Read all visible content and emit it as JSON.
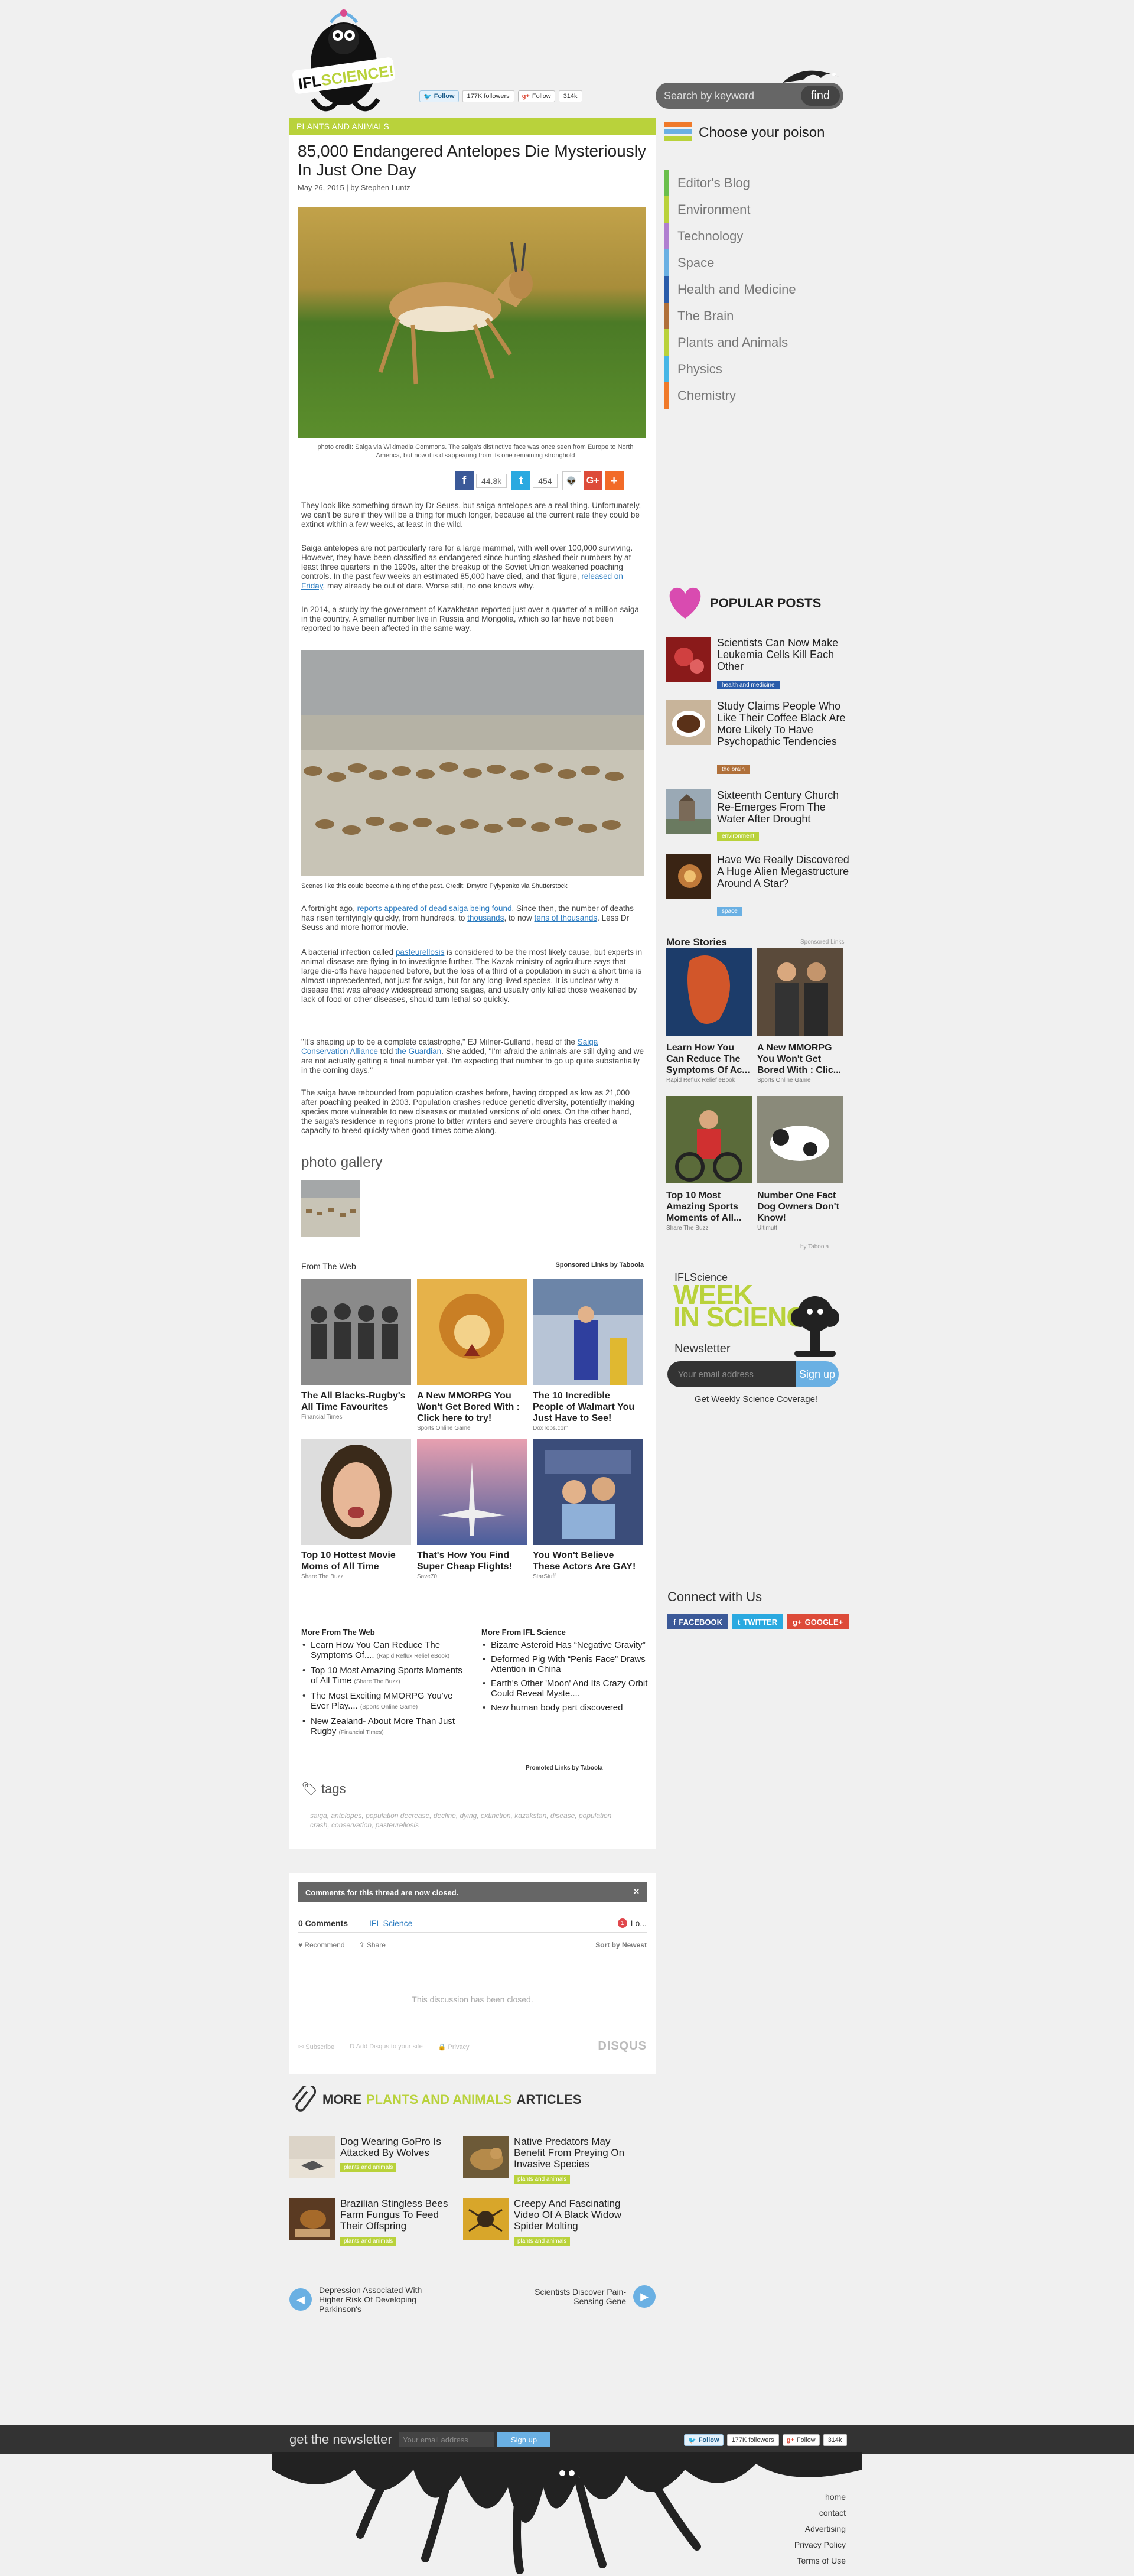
{
  "header": {
    "search_placeholder": "Search by keyword",
    "search_button": "find",
    "twitter_follow": "Follow",
    "twitter_followers": "177K followers",
    "gplus_follow": "Follow",
    "gplus_count": "314k",
    "logo_text": "IFL SCIENCE!"
  },
  "article": {
    "category": "PLANTS AND ANIMALS",
    "title": "85,000 Endangered Antelopes Die Mysteriously In Just One Day",
    "byline": "May 26, 2015 | by Stephen Luntz",
    "hero_caption": "photo credit: Saiga via Wikimedia Commons. The saiga's distinctive face was once seen from Europe to North America, but now it is disappearing from its one remaining stronghold",
    "share": {
      "facebook_count": "44.8k",
      "twitter_count": "454"
    },
    "p1": "They look like something drawn by Dr Seuss, but saiga antelopes are a real thing. Unfortunately, we can't be sure if they will be a thing for much longer, because at the current rate they could be extinct within a few weeks, at least in the wild.",
    "p2a": "Saiga antelopes are not particularly rare for a large mammal, with well over 100,000 surviving. However, they have been classified as endangered since hunting slashed their numbers by at least three quarters in the 1990s, after the breakup of the Soviet Union weakened poaching controls. In the past few weeks an estimated 85,000 have died, and that figure,",
    "p2_link": "released on Friday",
    "p2b": ", may already be out of date. Worse still, no one knows why.",
    "p3": "In 2014, a study by the government of Kazakhstan reported just over a quarter of a million saiga in the country. A smaller number live in Russia and Mongolia, which so far have not been reported to have been affected in the same way.",
    "caption2": "Scenes like this could become a thing of the past. Credit: Dmytro Pylypenko via Shutterstock",
    "p4a": "A fortnight ago,",
    "p4_link1": "reports appeared of dead saiga being found",
    "p4b": ". Since then, the number of deaths has risen terrifyingly quickly, from hundreds, to",
    "p4_link2": "thousands",
    "p4c": ", to now",
    "p4_link3": "tens of thousands",
    "p4d": ". Less Dr Seuss and more horror movie.",
    "p5a": "A bacterial infection called",
    "p5_link": "pasteurellosis",
    "p5b": "is considered to be the most likely cause, but experts in animal disease are flying in to investigate further. The Kazak ministry of agriculture says that large die-offs have happened before, but the loss of a third of a population in such a short time is almost unprecedented, not just for saiga, but for any long-lived species. It is unclear why a disease that was already widespread among saigas, and usually only killed those weakened by lack of food or other diseases, should turn lethal so quickly.",
    "p6a": "\"It's shaping up to be a complete catastrophe,\" EJ Milner-Gulland, head of the",
    "p6_link1": "Saiga Conservation Alliance",
    "p6b": "told",
    "p6_link2": "the Guardian",
    "p6c": ". She added, \"I'm afraid the animals are still dying and we are not actually getting a final number yet. I'm expecting that number to go up quite substantially in the coming days.\"",
    "p7": "The saiga have rebounded from population crashes before, having dropped as low as 21,000 after poaching peaked in 2003. Population crashes reduce genetic diversity, potentially making species more vulnerable to new diseases or mutated versions of old ones. On the other hand, the saiga's residence in regions prone to bitter winters and severe droughts has created a capacity to breed quickly when good times come along.",
    "gallery_heading": "photo gallery",
    "tags_heading": "tags",
    "tags": "saiga, antelopes, population decrease, decline, dying, extinction, kazakstan, disease, population crash, conservation, pasteurellosis"
  },
  "from_web": {
    "heading": "From The Web",
    "sponsored": "Sponsored Links by Taboola",
    "cards": [
      {
        "title": "The All Blacks-Rugby's All Time Favourites",
        "src": "Financial Times"
      },
      {
        "title": "A New MMORPG You Won't Get Bored With : Click here to try!",
        "src": "Sports Online Game"
      },
      {
        "title": "The 10 Incredible People of Walmart You Just Have to See!",
        "src": "DoxTops.com"
      },
      {
        "title": "Top 10 Hottest Movie Moms of All Time",
        "src": "Share The Buzz"
      },
      {
        "title": "That's How You Find Super Cheap Flights!",
        "src": "Save70"
      },
      {
        "title": "You Won't Believe These Actors Are GAY!",
        "src": "StarStuff"
      }
    ]
  },
  "more_lists": {
    "left_heading": "More From The Web",
    "left": [
      {
        "text": "Learn How You Can Reduce The Symptoms Of....",
        "src": "(Rapid Reflux Relief eBook)"
      },
      {
        "text": "Top 10 Most Amazing Sports Moments of All Time",
        "src": "(Share The Buzz)"
      },
      {
        "text": "The Most Exciting MMORPG You've Ever Play....",
        "src": "(Sports Online Game)"
      },
      {
        "text": "New Zealand- About More Than Just Rugby",
        "src": "(Financial Times)"
      }
    ],
    "right_heading": "More From IFL Science",
    "right": [
      {
        "text": "Bizarre Asteroid Has “Negative Gravity”"
      },
      {
        "text": "Deformed Pig With “Penis Face” Draws Attention in China"
      },
      {
        "text": "Earth's Other 'Moon' And Its Crazy Orbit Could Reveal Myste...."
      },
      {
        "text": "New human body part discovered"
      }
    ],
    "promoted": "Promoted Links by Taboola"
  },
  "comments": {
    "closed_bar": "Comments for this thread are now closed.",
    "count": "0 Comments",
    "community": "IFL Science",
    "login": "Lo...",
    "recommend": "Recommend",
    "share": "Share",
    "sort": "Sort by Newest",
    "closed_msg": "This discussion has been closed.",
    "subscribe": "Subscribe",
    "add_disqus": "Add Disqus to your site",
    "privacy": "Privacy",
    "disqus": "DISQUS"
  },
  "more_articles": {
    "heading_pre": "MORE",
    "heading_cat": "PLANTS AND ANIMALS",
    "heading_post": "ARTICLES",
    "items": [
      {
        "title": "Dog Wearing GoPro Is Attacked By Wolves",
        "tag": "plants and animals"
      },
      {
        "title": "Native Predators May Benefit From Preying On Invasive Species",
        "tag": "plants and animals"
      },
      {
        "title": "Brazilian Stingless Bees Farm Fungus To Feed Their Offspring",
        "tag": "plants and animals"
      },
      {
        "title": "Creepy And Fascinating Video Of A Black Widow Spider Molting",
        "tag": "plants and animals"
      }
    ],
    "prev": "Depression Associated With Higher Risk Of Developing Parkinson's",
    "next": "Scientists Discover Pain-Sensing Gene"
  },
  "sidebar": {
    "choose_heading": "Choose your poison",
    "categories": [
      {
        "label": "Editor's Blog",
        "color": "#6abf4b"
      },
      {
        "label": "Environment",
        "color": "#b9d23b"
      },
      {
        "label": "Technology",
        "color": "#b07fd0"
      },
      {
        "label": "Space",
        "color": "#6ab0e3"
      },
      {
        "label": "Health and Medicine",
        "color": "#2a5caa"
      },
      {
        "label": "The Brain",
        "color": "#b0703a"
      },
      {
        "label": "Plants and Animals",
        "color": "#b9d23b"
      },
      {
        "label": "Physics",
        "color": "#47b6e6"
      },
      {
        "label": "Chemistry",
        "color": "#f07a2a"
      }
    ],
    "popular_heading": "POPULAR POSTS",
    "popular": [
      {
        "title": "Scientists Can Now Make Leukemia Cells Kill Each Other",
        "tag": "health and medicine",
        "tag_color": "#2a5caa"
      },
      {
        "title": "Study Claims People Who Like Their Coffee Black Are More Likely To Have Psychopathic Tendencies",
        "tag": "the brain",
        "tag_color": "#b0703a"
      },
      {
        "title": "Sixteenth Century Church Re-Emerges From The Water After Drought",
        "tag": "environment",
        "tag_color": "#b9d23b"
      },
      {
        "title": "Have We Really Discovered A Huge Alien Megastructure Around A Star?",
        "tag": "space",
        "tag_color": "#6ab0e3"
      }
    ],
    "more_stories_heading": "More Stories",
    "sponsored_links": "Sponsored Links",
    "stories": [
      {
        "title": "Learn How You Can Reduce The Symptoms Of Ac...",
        "src": "Rapid Reflux Relief eBook"
      },
      {
        "title": "A New MMORPG You Won't Get Bored With : Clic...",
        "src": "Sports Online Game"
      },
      {
        "title": "Top 10 Most Amazing Sports Moments of All...",
        "src": "Share The Buzz"
      },
      {
        "title": "Number One Fact Dog Owners Don't Know!",
        "src": "Ultimutt"
      }
    ],
    "by_taboola": "by Taboola",
    "wis_brand": "IFLScience",
    "wis_big1": "WEEK",
    "wis_big2": "IN",
    "wis_big3": "SCIENCE",
    "wis_newsletter": "Newsletter",
    "wis_placeholder": "Your email address",
    "wis_button": "Sign up",
    "wis_note": "Get Weekly Science Coverage!",
    "connect_heading": "Connect with Us",
    "connect": {
      "facebook": "FACEBOOK",
      "twitter": "TWITTER",
      "google": "GOOGLE+"
    }
  },
  "footer": {
    "newsletter": "get the newsletter",
    "placeholder": "Your email address",
    "signup": "Sign up",
    "twitter_follow": "Follow",
    "twitter_followers": "177K followers",
    "gplus_follow": "Follow",
    "gplus_count": "314k",
    "links": [
      "home",
      "contact",
      "Advertising",
      "Privacy Policy",
      "Terms of Use"
    ]
  }
}
